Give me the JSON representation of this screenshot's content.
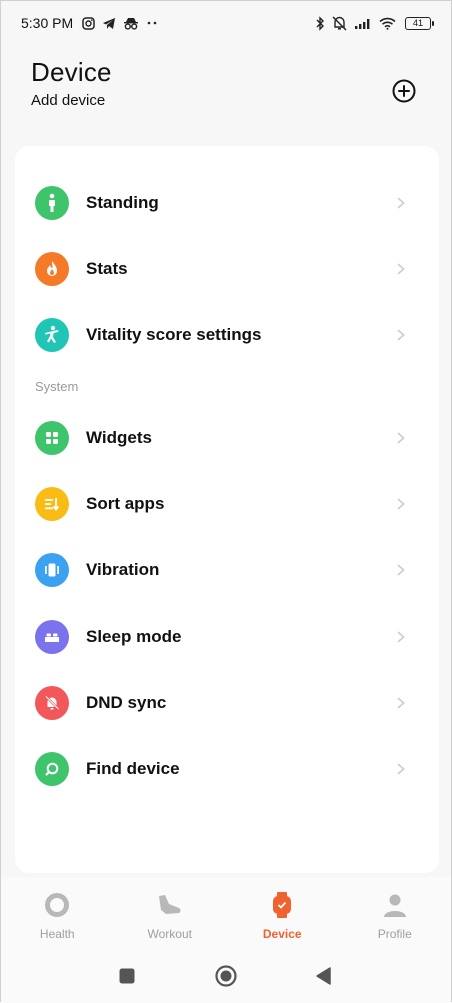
{
  "status_bar": {
    "time": "5:30 PM",
    "battery": "41",
    "left_icons": [
      "instagram-icon",
      "telegram-icon",
      "incognito-icon",
      "more-dots-icon"
    ],
    "right_icons": [
      "bluetooth-icon",
      "mute-icon",
      "signal-icon",
      "wifi-icon",
      "battery-icon"
    ]
  },
  "header": {
    "title": "Device",
    "subtitle": "Add device",
    "add_icon": "plus-circle-icon"
  },
  "menu": {
    "items_top": [
      {
        "label": "Standing",
        "icon": "person-standing-icon",
        "color": "#3ec46b"
      },
      {
        "label": "Stats",
        "icon": "flame-icon",
        "color": "#f47a28"
      },
      {
        "label": "Vitality score settings",
        "icon": "vitality-icon",
        "color": "#1fc5b5"
      }
    ],
    "section_label": "System",
    "items_system": [
      {
        "label": "Widgets",
        "icon": "grid-icon",
        "color": "#3ec46b"
      },
      {
        "label": "Sort apps",
        "icon": "sort-icon",
        "color": "#f9bb14"
      },
      {
        "label": "Vibration",
        "icon": "vibration-icon",
        "color": "#3aa2f0"
      },
      {
        "label": "Sleep mode",
        "icon": "bed-icon",
        "color": "#7b72ee"
      },
      {
        "label": "DND sync",
        "icon": "bell-off-icon",
        "color": "#f2575a"
      },
      {
        "label": "Find device",
        "icon": "search-icon",
        "color": "#3ec46b"
      }
    ]
  },
  "tabs": [
    {
      "label": "Health",
      "icon": "ring-icon",
      "active": false
    },
    {
      "label": "Workout",
      "icon": "shoe-icon",
      "active": false
    },
    {
      "label": "Device",
      "icon": "watch-icon",
      "active": true
    },
    {
      "label": "Profile",
      "icon": "person-icon",
      "active": false
    }
  ],
  "colors": {
    "accent": "#f0622f",
    "inactive": "#b8b8b8"
  }
}
